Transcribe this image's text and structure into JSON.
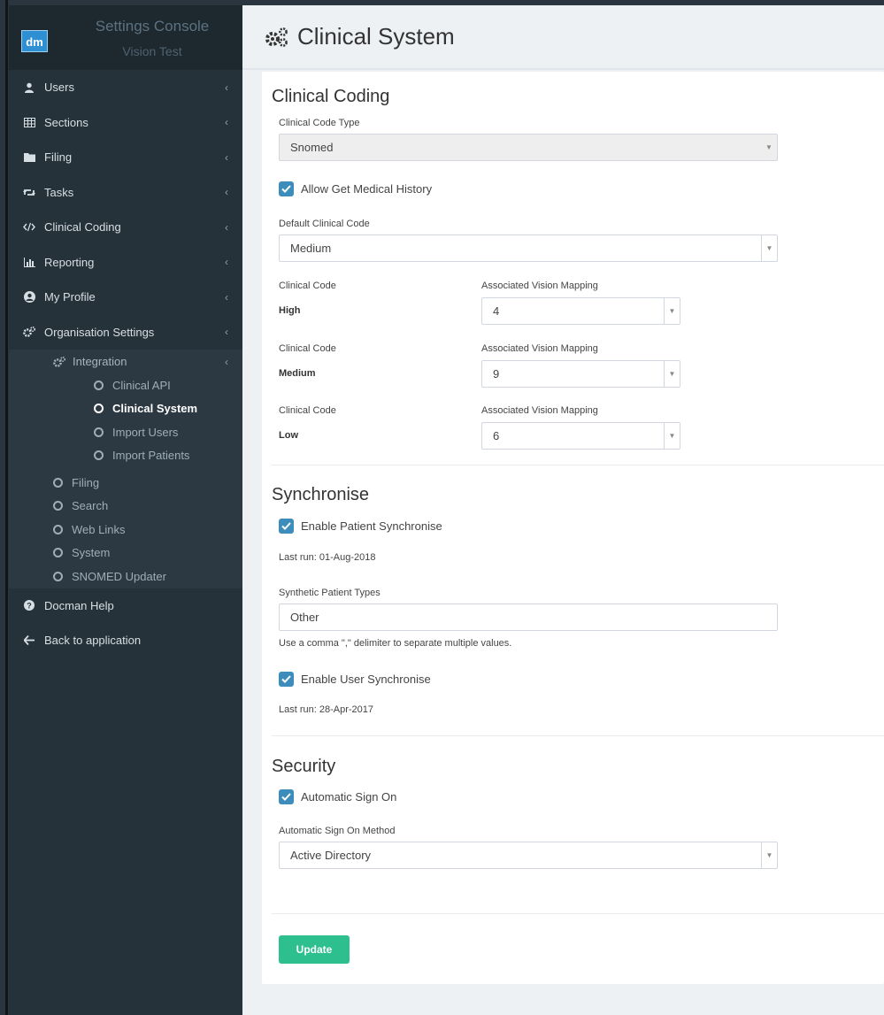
{
  "brand": {
    "logo": "dm",
    "title": "Settings Console",
    "subtitle": "Vision Test"
  },
  "sidebar": {
    "items": [
      {
        "label": "Users",
        "icon": "user-icon"
      },
      {
        "label": "Sections",
        "icon": "table-icon"
      },
      {
        "label": "Filing",
        "icon": "folder-icon"
      },
      {
        "label": "Tasks",
        "icon": "retweet-icon"
      },
      {
        "label": "Clinical Coding",
        "icon": "code-icon"
      },
      {
        "label": "Reporting",
        "icon": "bar-chart-icon"
      },
      {
        "label": "My Profile",
        "icon": "user-circle-icon"
      },
      {
        "label": "Organisation Settings",
        "icon": "cogs-icon"
      }
    ],
    "integration": {
      "label": "Integration",
      "children": [
        "Clinical API",
        "Clinical System",
        "Import Users",
        "Import Patients"
      ],
      "active": "Clinical System"
    },
    "org_children": [
      "Filing",
      "Search",
      "Web Links",
      "System",
      "SNOMED Updater"
    ],
    "help": "Docman Help",
    "back": "Back to application"
  },
  "header": {
    "title": "Clinical System",
    "icon": "cogs-icon"
  },
  "clinical_coding": {
    "title": "Clinical Coding",
    "code_type_label": "Clinical Code Type",
    "code_type_value": "Snomed",
    "allow_history": "Allow Get Medical History",
    "default_code_label": "Default Clinical Code",
    "default_code_value": "Medium",
    "code_label": "Clinical Code",
    "mapping_label": "Associated Vision Mapping",
    "mappings": [
      {
        "code": "High",
        "value": "4"
      },
      {
        "code": "Medium",
        "value": "9"
      },
      {
        "code": "Low",
        "value": "6"
      }
    ]
  },
  "synchronise": {
    "title": "Synchronise",
    "patient_sync": "Enable Patient Synchronise",
    "patient_last_run": "Last run: 01-Aug-2018",
    "synthetic_label": "Synthetic Patient Types",
    "synthetic_value": "Other",
    "synthetic_hint": "Use a comma \",\" delimiter to separate multiple values.",
    "user_sync": "Enable User Synchronise",
    "user_last_run": "Last run: 28-Apr-2017"
  },
  "security": {
    "title": "Security",
    "auto_sign_on": "Automatic Sign On",
    "method_label": "Automatic Sign On Method",
    "method_value": "Active Directory"
  },
  "actions": {
    "update": "Update"
  },
  "colors": {
    "sidebar_bg": "#26323a",
    "checkbox": "#3c8dbc",
    "update_button": "#2ebf8f"
  }
}
